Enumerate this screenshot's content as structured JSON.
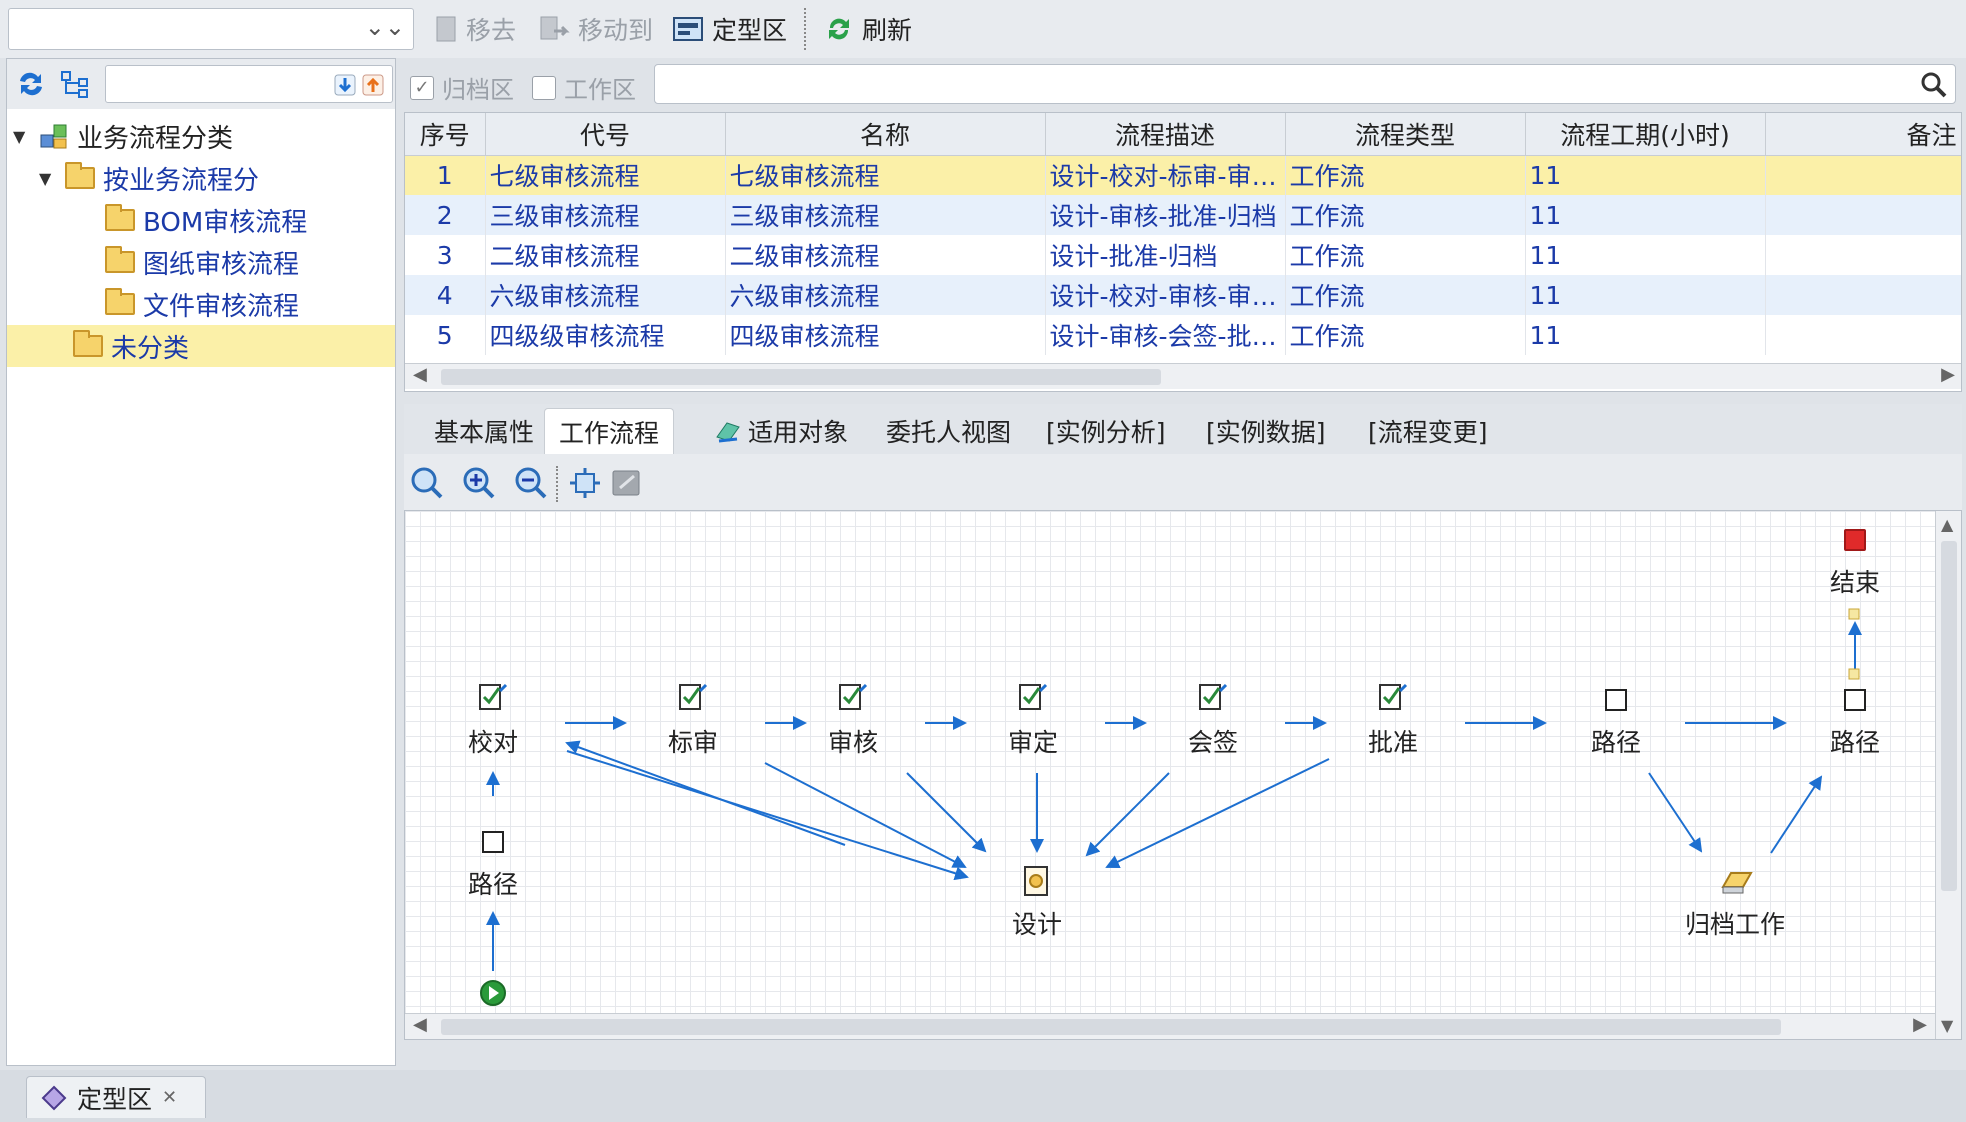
{
  "toolbar": {
    "move_away": "移去",
    "move_to": "移动到",
    "fixed_zone": "定型区",
    "refresh": "刷新"
  },
  "filters": {
    "archive_zone": "归档区",
    "work_zone": "工作区"
  },
  "tree": {
    "root": "业务流程分类",
    "group": "按业务流程分",
    "children": [
      "BOM审核流程",
      "图纸审核流程",
      "文件审核流程"
    ],
    "uncategorized": "未分类"
  },
  "table": {
    "headers": [
      "序号",
      "代号",
      "名称",
      "流程描述",
      "流程类型",
      "流程工期(小时)",
      "备注"
    ],
    "rows": [
      [
        "1",
        "七级审核流程",
        "七级审核流程",
        "设计-校对-标审-审核...",
        "工作流",
        "11",
        ""
      ],
      [
        "2",
        "三级审核流程",
        "三级审核流程",
        "设计-审核-批准-归档",
        "工作流",
        "11",
        ""
      ],
      [
        "3",
        "二级审核流程",
        "二级审核流程",
        "设计-批准-归档",
        "工作流",
        "11",
        ""
      ],
      [
        "4",
        "六级审核流程",
        "六级审核流程",
        "设计-校对-审核-审定...",
        "工作流",
        "11",
        ""
      ],
      [
        "5",
        "四级级审核流程",
        "四级审核流程",
        "设计-审核-会签-批准...",
        "工作流",
        "11",
        ""
      ]
    ]
  },
  "tabs": [
    "基本属性",
    "工作流程",
    "适用对象",
    "委托人视图",
    "[实例分析]",
    "[实例数据]",
    "[流程变更]"
  ],
  "diagram": {
    "nodes": {
      "proofread": "校对",
      "standard": "标审",
      "review": "审核",
      "approve_final": "审定",
      "countersign": "会签",
      "approve": "批准",
      "path1": "路径",
      "path2": "路径",
      "end": "结束",
      "path_left": "路径",
      "design": "设计",
      "archive": "归档工作"
    }
  },
  "status": {
    "tab": "定型区"
  },
  "colors": {
    "selection": "#fbf0a8",
    "alt_row": "#e7f0fb",
    "link_text": "#1b3aa8",
    "arrow": "#1d6fd0"
  }
}
